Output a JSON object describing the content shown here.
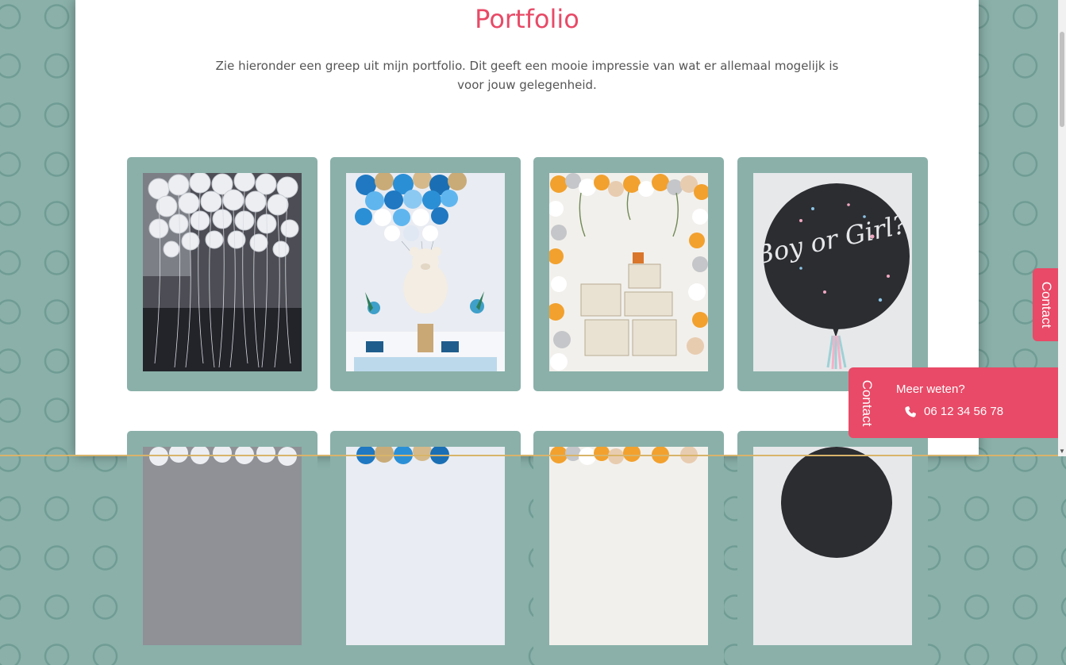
{
  "portfolio": {
    "title": "Portfolio",
    "intro": "Zie hieronder een greep uit mijn portfolio. Dit geeft een mooie impressie van wat er allemaal mogelijk is voor jouw gelegenheid."
  },
  "gallery": {
    "items": [
      {
        "icon": "white-balloons-photo"
      },
      {
        "icon": "teddy-bear-blue-balloons-photo"
      },
      {
        "icon": "balloon-arch-crates-photo"
      },
      {
        "icon": "boy-or-girl-balloon-photo",
        "text": "Boy or Girl?"
      }
    ]
  },
  "contact_tab": {
    "label": "Contact"
  },
  "contact_popup": {
    "label": "Contact",
    "heading": "Meer weten?",
    "phone": "06 12 34 56 78",
    "icon": "phone-icon"
  },
  "colors": {
    "accent": "#e84a67",
    "card": "#8ab0a9",
    "background": "#8ab0a9"
  }
}
